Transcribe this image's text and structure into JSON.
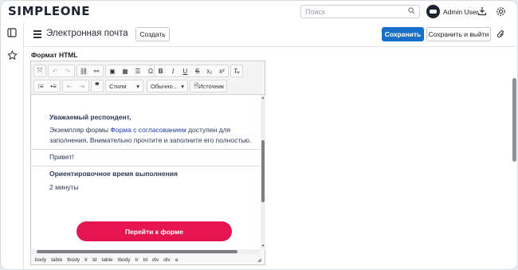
{
  "app": {
    "logo": "SIMPLEONE",
    "user_name": "Admin User"
  },
  "search": {
    "placeholder": "Поиск"
  },
  "form": {
    "title": "Электронная почта",
    "create_label": "Создать",
    "save_label": "Сохранить",
    "save_exit_label": "Сохранить и выйти"
  },
  "field": {
    "label": "Формат HTML"
  },
  "toolbar": {
    "styles_label": "Стили",
    "format_label": "Обычно…",
    "source_label": "Источник"
  },
  "content": {
    "greeting": "Уважаемый респондент,",
    "line1_prefix": "Экземпляр формы ",
    "form_link": "Форма с согласованием",
    "line1_suffix": " доступен для",
    "line2": "заполнения. Внимательно прочтите и заполните его полностью.",
    "hello": "Привет!",
    "time_title": "Ориентировочное время выполнения",
    "time_value": "2 минуты",
    "cta_label": "Перейти к форме"
  },
  "statusbar": [
    "body",
    "table",
    "tbody",
    "tr",
    "td",
    "table",
    "tbody",
    "tr",
    "td",
    "div",
    "div",
    "a"
  ]
}
